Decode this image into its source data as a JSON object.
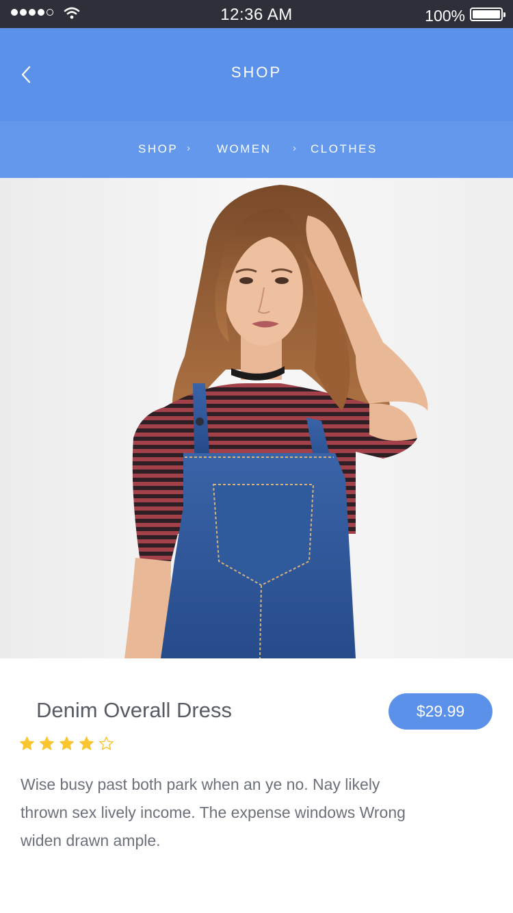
{
  "status_bar": {
    "time": "12:36 AM",
    "battery_percent": "100%",
    "battery_level": 1.0,
    "signal_bars_filled": 4,
    "signal_bars_total": 5,
    "icons": [
      "signal-icon",
      "wifi-icon",
      "battery-icon"
    ]
  },
  "header": {
    "title": "SHOP",
    "back_icon": "chevron-left-icon"
  },
  "breadcrumb": {
    "items": [
      "SHOP",
      "WOMEN",
      "CLOTHES"
    ],
    "separator_icon": "chevron-right-icon"
  },
  "product": {
    "image_alt": "Model wearing denim overall dress with striped red shirt",
    "title": "Denim Overall Dress",
    "price": "$29.99",
    "rating": 4,
    "rating_max": 5,
    "description": "Wise busy past both park when an ye no. Nay likely thrown sex lively income. The expense windows Wrong widen drawn ample."
  },
  "colors": {
    "status_bar": "#2d3039",
    "header": "#5b91e8",
    "breadcrumb": "#6398ec",
    "accent": "#5b91e8",
    "star": "#f9c531",
    "text_dark": "#555a63",
    "text_body": "#6b7079"
  }
}
